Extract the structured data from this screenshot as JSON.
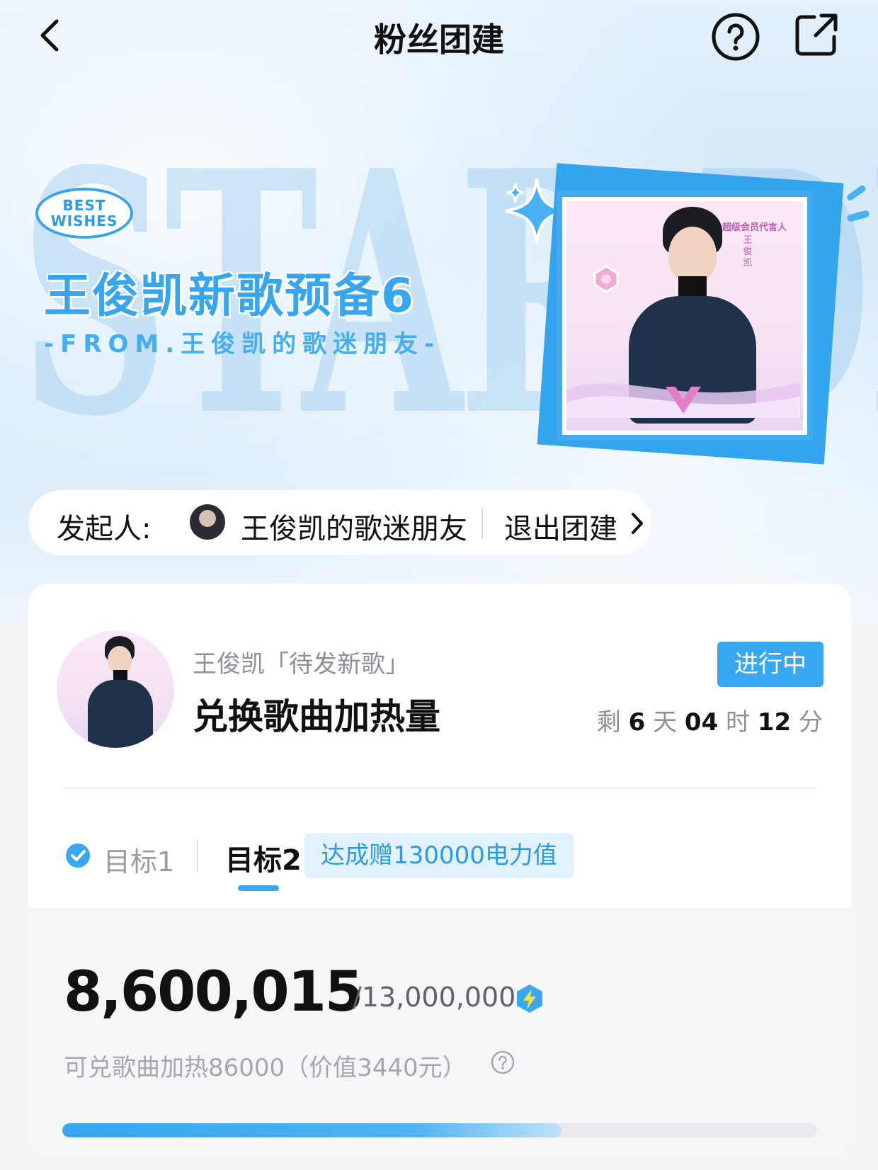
{
  "header": {
    "title": "粉丝团建",
    "back_icon": "chevron-left-icon",
    "help_icon": "question-circle-icon",
    "share_icon": "external-share-icon"
  },
  "hero": {
    "background_text": "STAR DR",
    "badge_line1": "BEST",
    "badge_line2": "WISHES",
    "title": "王俊凯新歌预备6",
    "from": "-FROM.王俊凯的歌迷朋友-",
    "poster_caption_line1": "超级会员代言人",
    "poster_caption_name": "王俊凯"
  },
  "organizer": {
    "label": "发起人:",
    "name": "王俊凯的歌迷朋友",
    "exit_label": "退出团建"
  },
  "task": {
    "subtitle": "王俊凯「待发新歌」",
    "title": "兑换歌曲加热量",
    "status": "进行中",
    "countdown": {
      "prefix": "剩",
      "days": "6",
      "days_unit": "天",
      "hours": "04",
      "hours_unit": "时",
      "minutes": "12",
      "minutes_unit": "分"
    }
  },
  "goals": {
    "goal1_label": "目标1",
    "goal1_completed": true,
    "goal2_label": "目标2",
    "reward": "达成赠130000电力值"
  },
  "progress": {
    "current": "8,600,015",
    "target": "/13,000,000",
    "note": "可兑歌曲加热86000（价值3440元）",
    "fraction": 0.6615,
    "accent_color": "#36a7f0"
  }
}
